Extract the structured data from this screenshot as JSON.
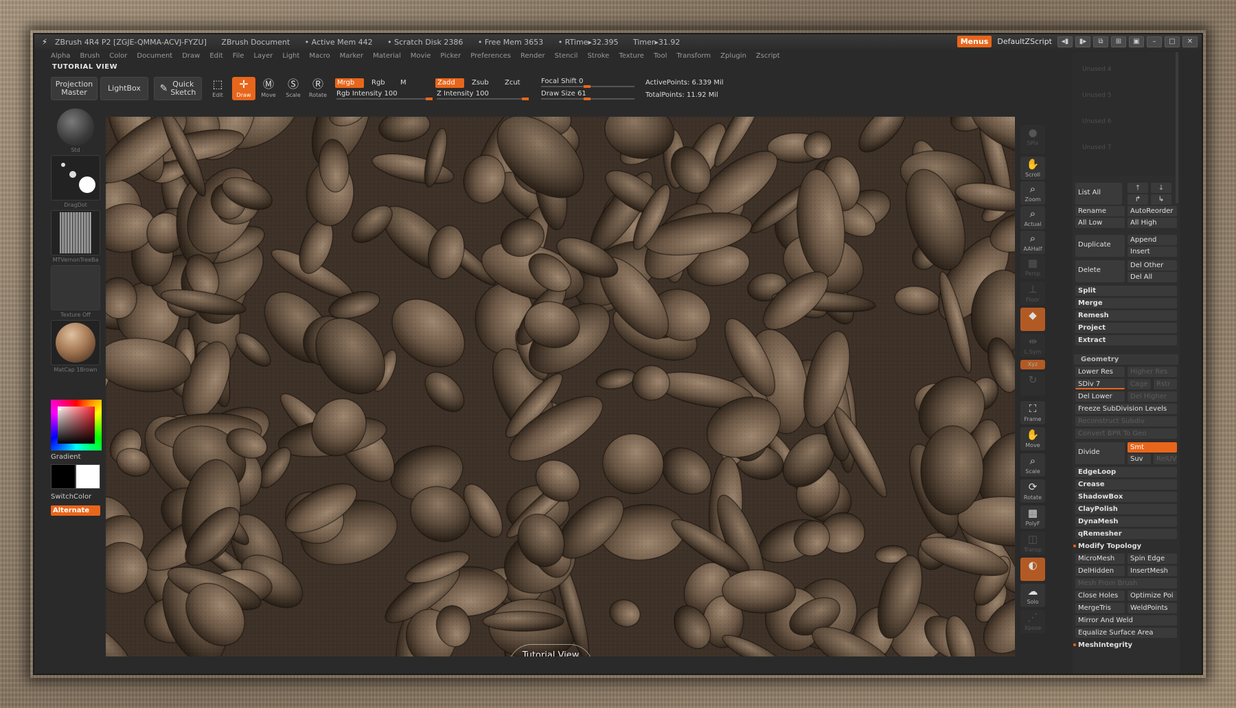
{
  "title_bar": {
    "app_title": "ZBrush 4R4 P2 [ZGJE-QMMA-ACVJ-FYZU]",
    "document": "ZBrush Document",
    "active_mem": "• Active Mem 442",
    "scratch_disk": "• Scratch Disk 2386",
    "free_mem": "• Free Mem 3653",
    "rtime": "• RTime▸32.395",
    "timer": "Timer▸31.92",
    "menus_label": "Menus",
    "script_label": "DefaultZScript"
  },
  "menu": [
    "Alpha",
    "Brush",
    "Color",
    "Document",
    "Draw",
    "Edit",
    "File",
    "Layer",
    "Light",
    "Macro",
    "Marker",
    "Material",
    "Movie",
    "Picker",
    "Preferences",
    "Render",
    "Stencil",
    "Stroke",
    "Texture",
    "Tool",
    "Transform",
    "Zplugin",
    "Zscript"
  ],
  "tutorial_label": "TUTORIAL VIEW",
  "shelf": {
    "projection_master_1": "Projection",
    "projection_master_2": "Master",
    "lightbox": "LightBox",
    "quick_sketch_1": "Quick",
    "quick_sketch_2": "Sketch",
    "edit": "Edit",
    "draw": "Draw",
    "move": "Move",
    "scale": "Scale",
    "rotate": "Rotate",
    "mrgb": "Mrgb",
    "rgb": "Rgb",
    "m": "M",
    "zadd": "Zadd",
    "zsub": "Zsub",
    "zcut": "Zcut",
    "rgb_intensity": "Rgb Intensity 100",
    "z_intensity": "Z Intensity 100",
    "focal_shift": "Focal Shift 0",
    "draw_size": "Draw Size 61",
    "active_points": "ActivePoints: 6.339 Mil",
    "total_points": "TotalPoints: 11.92 Mil"
  },
  "left_tray": {
    "brush_caption": "Std",
    "stroke_caption": "DragDot",
    "alpha_caption": "MTVernonTreeBa",
    "texture_caption": "Texture Off",
    "material_caption": "MatCap 1Brown",
    "gradient": "Gradient",
    "switch_color": "SwitchColor",
    "alternate": "Alternate"
  },
  "viewport": {
    "tutorial_view": "Tutorial View"
  },
  "right_shelf": {
    "spix": "SPix",
    "scroll": "Scroll",
    "zoom": "Zoom",
    "actual": "Actual",
    "aahalf": "AAHalf",
    "persp": "Persp",
    "floor": "Floor",
    "local": "Local",
    "lsym": "L.Sym",
    "xyz": "Xyz",
    "frame": "Frame",
    "move": "Move",
    "scale": "Scale",
    "rotate": "Rotate",
    "polyf": "PolyF",
    "transp": "Transp",
    "ghost": "Ghost",
    "solo": "Solo",
    "xpose": "Xpose"
  },
  "subtool_panel": {
    "ghost_items": [
      "Unused 4",
      "Unused 5",
      "Unused 6",
      "Unused 7"
    ],
    "list_all": "List All",
    "rename": "Rename",
    "auto_reorder": "AutoReorder",
    "all_low": "All Low",
    "all_high": "All High",
    "duplicate": "Duplicate",
    "append": "Append",
    "insert": "Insert",
    "delete": "Delete",
    "del_other": "Del Other",
    "del_all": "Del All",
    "split": "Split",
    "merge": "Merge",
    "remesh": "Remesh",
    "project": "Project",
    "extract": "Extract"
  },
  "geometry_panel": {
    "header": "Geometry",
    "lower_res": "Lower Res",
    "higher_res": "Higher Res",
    "sdiv": "SDiv 7",
    "sdiv_level": 7,
    "sdiv_max": 7,
    "cage": "Cage",
    "rstr": "Rstr",
    "del_lower": "Del Lower",
    "del_higher": "Del Higher",
    "freeze": "Freeze SubDivision Levels",
    "reconstruct": "Reconstruct Subdiv",
    "convert_bpr": "Convert BPR To Geo",
    "divide": "Divide",
    "smt": "Smt",
    "suv": "Suv",
    "reluv": "RelUV",
    "edgeloop": "EdgeLoop",
    "crease": "Crease",
    "shadowbox": "ShadowBox",
    "claypolish": "ClayPolish",
    "dynamesh": "DynaMesh",
    "qremesher": "qRemesher",
    "modify_topology": "Modify Topology",
    "micromesh": "MicroMesh",
    "spin_edge": "Spin Edge",
    "delhidden": "DelHidden",
    "insertmesh": "InsertMesh",
    "mesh_from_brush": "Mesh From Brush",
    "close_holes": "Close Holes",
    "optimize": "Optimize Poi",
    "mergetris": "MergeTris",
    "weldpoints": "WeldPoints",
    "mirror_weld": "Mirror And Weld",
    "equalize": "Equalize Surface Area",
    "meshintegrity": "MeshIntegrity"
  },
  "colors": {
    "accent": "#e8661b",
    "panel": "#2a2a2a",
    "frame": "#8e7e6a"
  }
}
